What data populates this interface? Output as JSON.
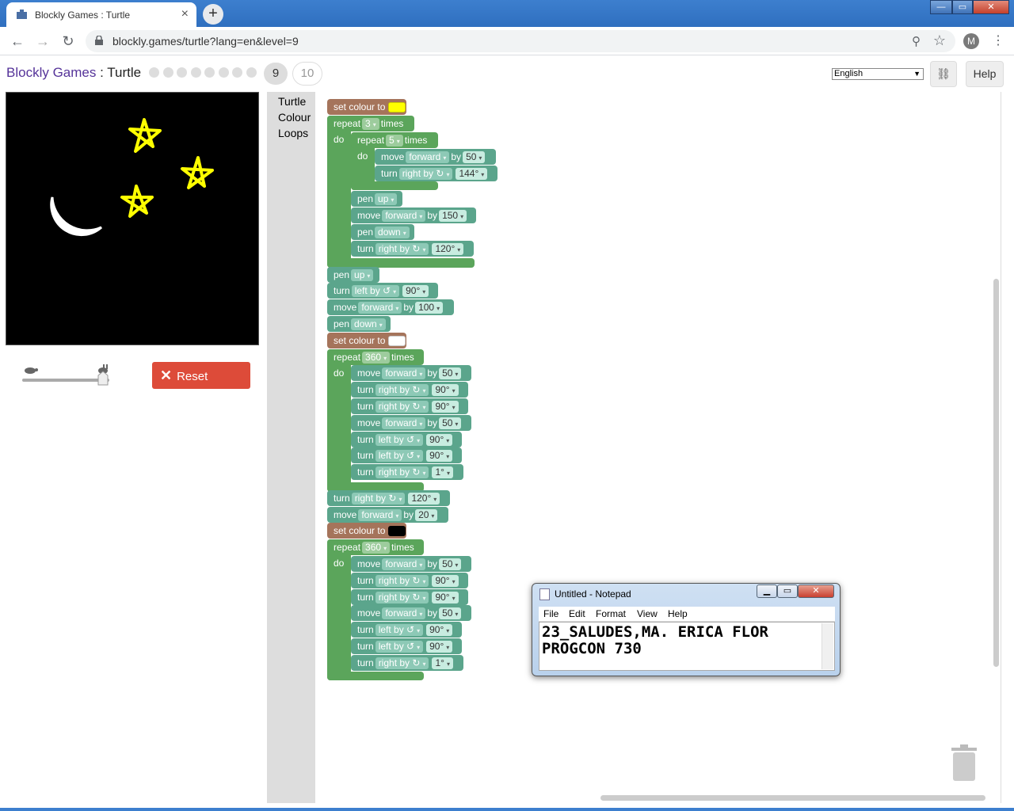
{
  "browser": {
    "tab_title": "Blockly Games : Turtle",
    "tab_close": "×",
    "new_tab": "+",
    "url": "blockly.games/turtle?lang=en&level=9",
    "profile_initial": "M"
  },
  "header": {
    "brand": "Blockly Games",
    "separator": " : ",
    "game": "Turtle",
    "levels_completed": 8,
    "current_level": "9",
    "next_level": "10",
    "language": "English",
    "help_label": "Help"
  },
  "controls": {
    "reset_label": "Reset"
  },
  "toolbox": {
    "categories": [
      "Turtle",
      "Colour",
      "Loops"
    ]
  },
  "blocks": {
    "set_colour": "set colour to",
    "repeat": "repeat",
    "times": "times",
    "do": "do",
    "move": "move",
    "turn": "turn",
    "pen": "pen",
    "by": "by",
    "forward": "forward",
    "up": "up",
    "down": "down",
    "right_by": "right by ↻",
    "left_by": "left by ↺",
    "colour1": "#ffff00",
    "colour2": "#ffffff",
    "colour3": "#000000",
    "repeat1_count": "3",
    "repeat2_count": "5",
    "move1": "50",
    "turn1": "144°",
    "move2": "150",
    "turn2": "120°",
    "turn3": "90°",
    "move3": "100",
    "repeat3_count": "360",
    "r3_move1": "50",
    "r3_turn1": "90°",
    "r3_turn2": "90°",
    "r3_move2": "50",
    "r3_turn3": "90°",
    "r3_turn4": "90°",
    "r3_turn5": "1°",
    "turn4": "120°",
    "move4": "20",
    "repeat4_count": "360",
    "r4_move1": "50",
    "r4_turn1": "90°",
    "r4_turn2": "90°",
    "r4_move2": "50",
    "r4_turn3": "90°",
    "r4_turn4": "90°",
    "r4_turn5": "1°"
  },
  "notepad": {
    "title": "Untitled - Notepad",
    "menu": [
      "File",
      "Edit",
      "Format",
      "View",
      "Help"
    ],
    "line1": "23_SALUDES,MA. ERICA FLOR",
    "line2": "PROGCON 730"
  },
  "colors": {
    "colour_block": "#a5745b",
    "loop_block": "#5ba55b",
    "turtle_block": "#5ba58c",
    "reset_button": "#dd4b39",
    "star": "#ffff00",
    "moon": "#ffffff"
  }
}
